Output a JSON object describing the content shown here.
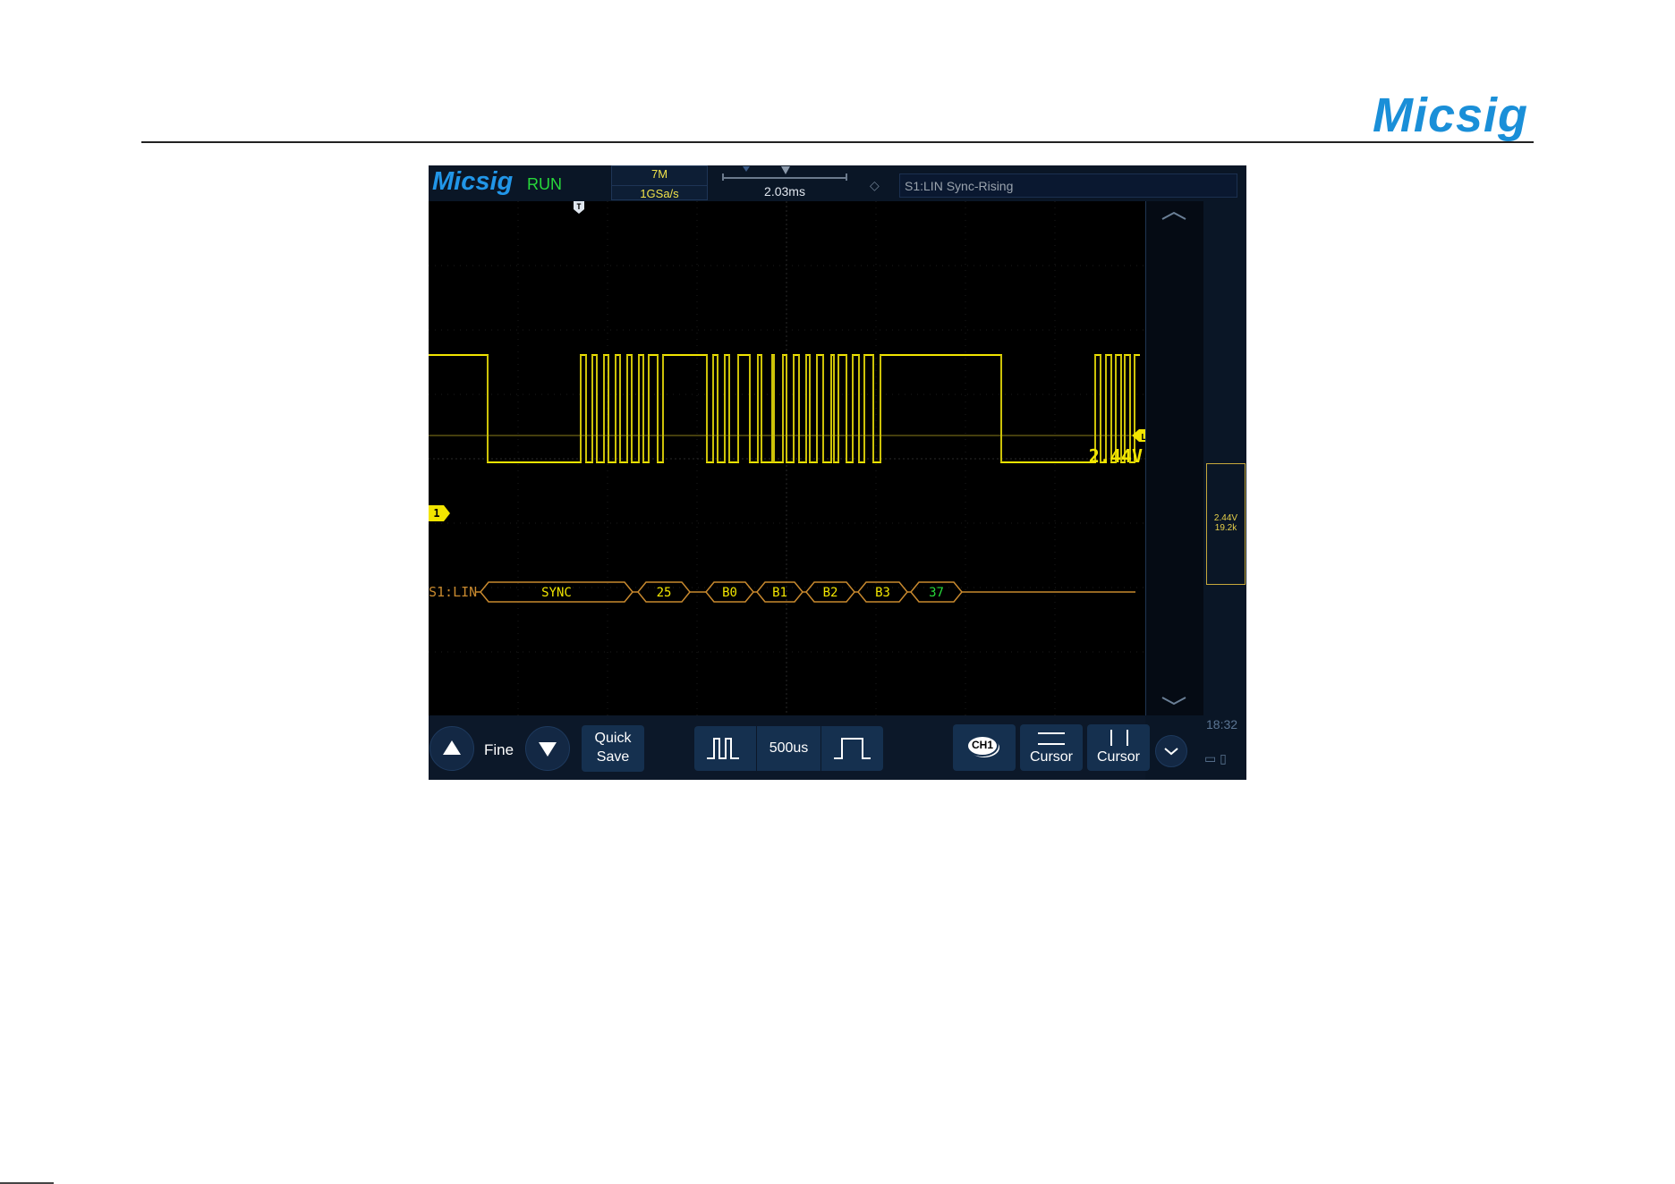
{
  "header": {
    "logo": "Micsig"
  },
  "scope": {
    "brand": "Micsig",
    "status": "RUN",
    "memory_depth": "7M",
    "sample_rate": "1GSa/s",
    "time_position": "2.03ms",
    "trigger_info": "S1:LIN Sync-Rising",
    "trigger_level": "2.44V",
    "channel_marker": "1",
    "trigger_marker": "T",
    "level_marker": "L",
    "decode_label": "S1:LIN",
    "decode_frames": [
      "SYNC",
      "25",
      "B0",
      "B1",
      "B2",
      "B3",
      "37"
    ],
    "channel_panel": {
      "level": "2.44V",
      "baud": "19.2k"
    },
    "clock": "18:32",
    "bottom": {
      "fine_label": "Fine",
      "quick_save_line1": "Quick",
      "quick_save_line2": "Save",
      "timebase": "500us",
      "ch_badge": "CH1",
      "cursor_h": "Cursor",
      "cursor_v": "Cursor"
    },
    "colors": {
      "trace": "#f2e500",
      "decode": "#c8892e",
      "background": "#000000",
      "run": "#27d83a"
    }
  }
}
